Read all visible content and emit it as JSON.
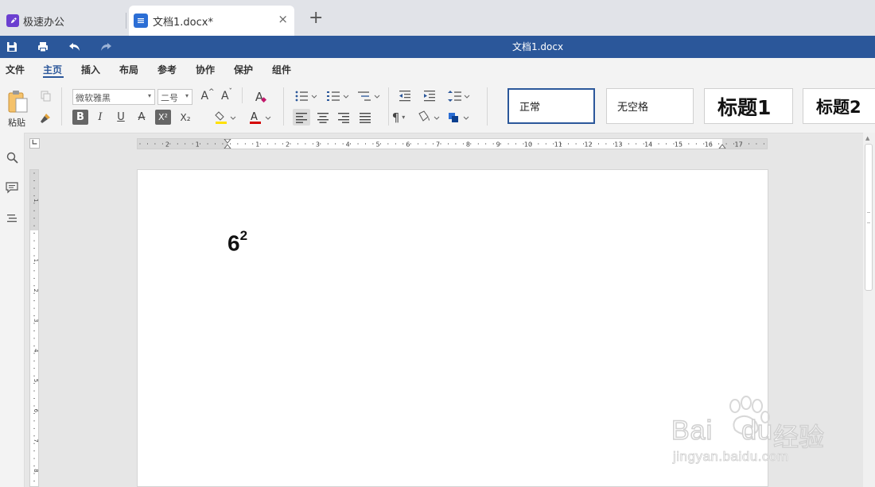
{
  "tabs": {
    "app_label": "极速办公",
    "doc_label": "文档1.docx*",
    "close_glyph": "×",
    "add_glyph": "+"
  },
  "titlebar": {
    "title": "文档1.docx"
  },
  "menu": {
    "items": [
      "文件",
      "主页",
      "插入",
      "布局",
      "参考",
      "协作",
      "保护",
      "组件"
    ],
    "active": "主页"
  },
  "ribbon": {
    "paste_label": "粘贴",
    "font_family": "微软雅黑",
    "font_size": "二号",
    "bold": "B",
    "italic": "I",
    "underline": "U",
    "strike": "A",
    "superscript": "X²",
    "subscript": "X₂",
    "styles": [
      "正常",
      "无空格",
      "标题1",
      "标题2"
    ],
    "selected_style": "正常"
  },
  "ruler": {
    "h_labels": [
      "2",
      "1",
      "1",
      "2",
      "3",
      "4",
      "5",
      "6",
      "7",
      "8",
      "9",
      "10",
      "11",
      "12",
      "13",
      "14",
      "15",
      "16",
      "17"
    ],
    "v_labels": [
      "1",
      "1",
      "2",
      "3",
      "4",
      "5",
      "6",
      "7",
      "8"
    ]
  },
  "document": {
    "base": "6",
    "exponent": "2"
  },
  "colors": {
    "accent": "#2b579a",
    "highlight": "#ffe000",
    "font_color": "#d40000",
    "app_icon": "#6b3fd0",
    "doc_icon": "#2b6ed5"
  },
  "watermark": {
    "brand": "Bai",
    "brand2": "du",
    "cn": "经验",
    "url": "jingyan.baidu.com"
  }
}
